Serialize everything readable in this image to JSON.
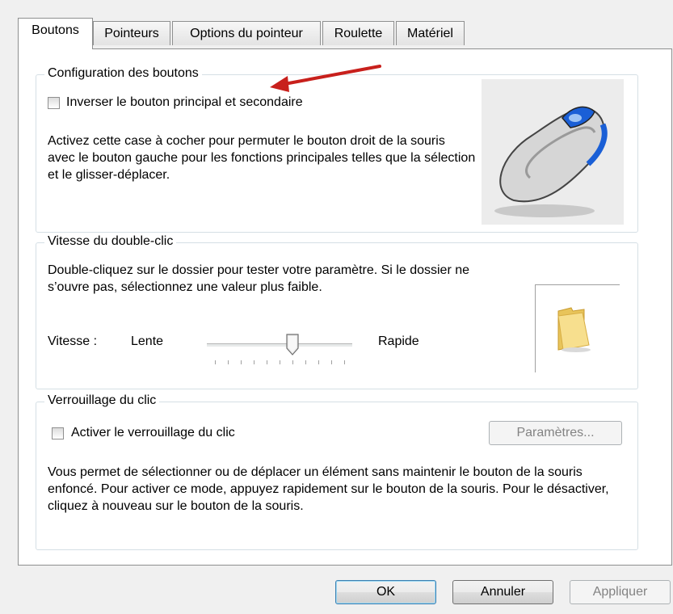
{
  "tabs": [
    {
      "label": "Boutons",
      "active": true
    },
    {
      "label": "Pointeurs",
      "active": false
    },
    {
      "label": "Options du pointeur",
      "active": false
    },
    {
      "label": "Roulette",
      "active": false
    },
    {
      "label": "Matériel",
      "active": false
    }
  ],
  "buttons_group": {
    "title": "Configuration des boutons",
    "checkbox_label": "Inverser le bouton principal et secondaire",
    "checked": false,
    "description": "Activez cette case à cocher pour permuter le bouton droit de la souris avec le bouton gauche pour les fonctions principales telles que la sélection et le glisser-déplacer."
  },
  "double_click_group": {
    "title": "Vitesse du double-clic",
    "description": "Double-cliquez sur le dossier pour tester votre paramètre. Si le dossier ne s’ouvre pas, sélectionnez une valeur plus faible.",
    "speed_label": "Vitesse :",
    "slow_label": "Lente",
    "fast_label": "Rapide",
    "slider_value": 0.6
  },
  "click_lock_group": {
    "title": "Verrouillage du clic",
    "checkbox_label": "Activer le verrouillage du clic",
    "checked": false,
    "settings_button": "Paramètres...",
    "description": "Vous permet de sélectionner ou de déplacer un élément sans maintenir le bouton de la souris enfoncé. Pour activer ce mode, appuyez rapidement sur le bouton de la souris. Pour le désactiver, cliquez à nouveau sur le bouton de la souris."
  },
  "footer": {
    "ok": "OK",
    "cancel": "Annuler",
    "apply": "Appliquer"
  },
  "colors": {
    "arrow": "#c8201c",
    "default_button_border": "#3c7fb1",
    "mouse_accent": "#1a5fd6"
  }
}
